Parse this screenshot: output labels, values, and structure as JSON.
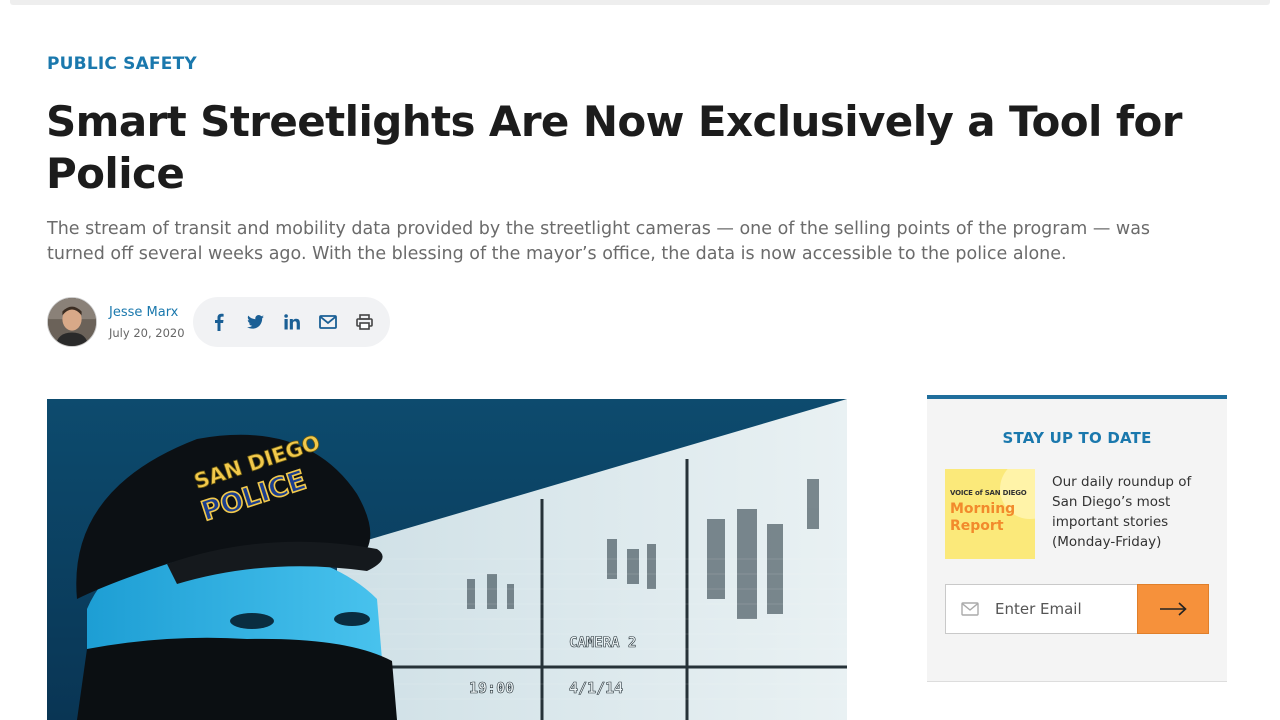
{
  "article": {
    "category": "PUBLIC SAFETY",
    "title": "Smart Streetlights Are Now Exclusively a Tool for Police",
    "dek": "The stream of transit and mobility data provided by the streetlight cameras — one of the selling points of the program — was turned off several weeks ago. With the blessing of the mayor’s office, the data is now accessible to the police alone.",
    "author": "Jesse Marx",
    "date": "July 20, 2020"
  },
  "share": {
    "icons": [
      "facebook-icon",
      "twitter-icon",
      "linkedin-icon",
      "mail-icon",
      "print-icon"
    ]
  },
  "hero": {
    "cap_text_top": "SAN DIEGO",
    "cap_text_bottom": "POLICE",
    "camera_label": "CAMERA 2",
    "time_label": "19:00",
    "date_label": "4/1/14"
  },
  "signup": {
    "heading": "STAY UP TO DATE",
    "logo_brand": "VOICE of SAN DIEGO",
    "logo_title": "Morning Report",
    "description": "Our daily roundup of San Diego’s most important stories (Monday-Friday)",
    "email_placeholder": "Enter Email"
  },
  "colors": {
    "accent_blue": "#1a78ad",
    "submit_orange": "#f6913b",
    "header_border": "#1f6e9c"
  }
}
